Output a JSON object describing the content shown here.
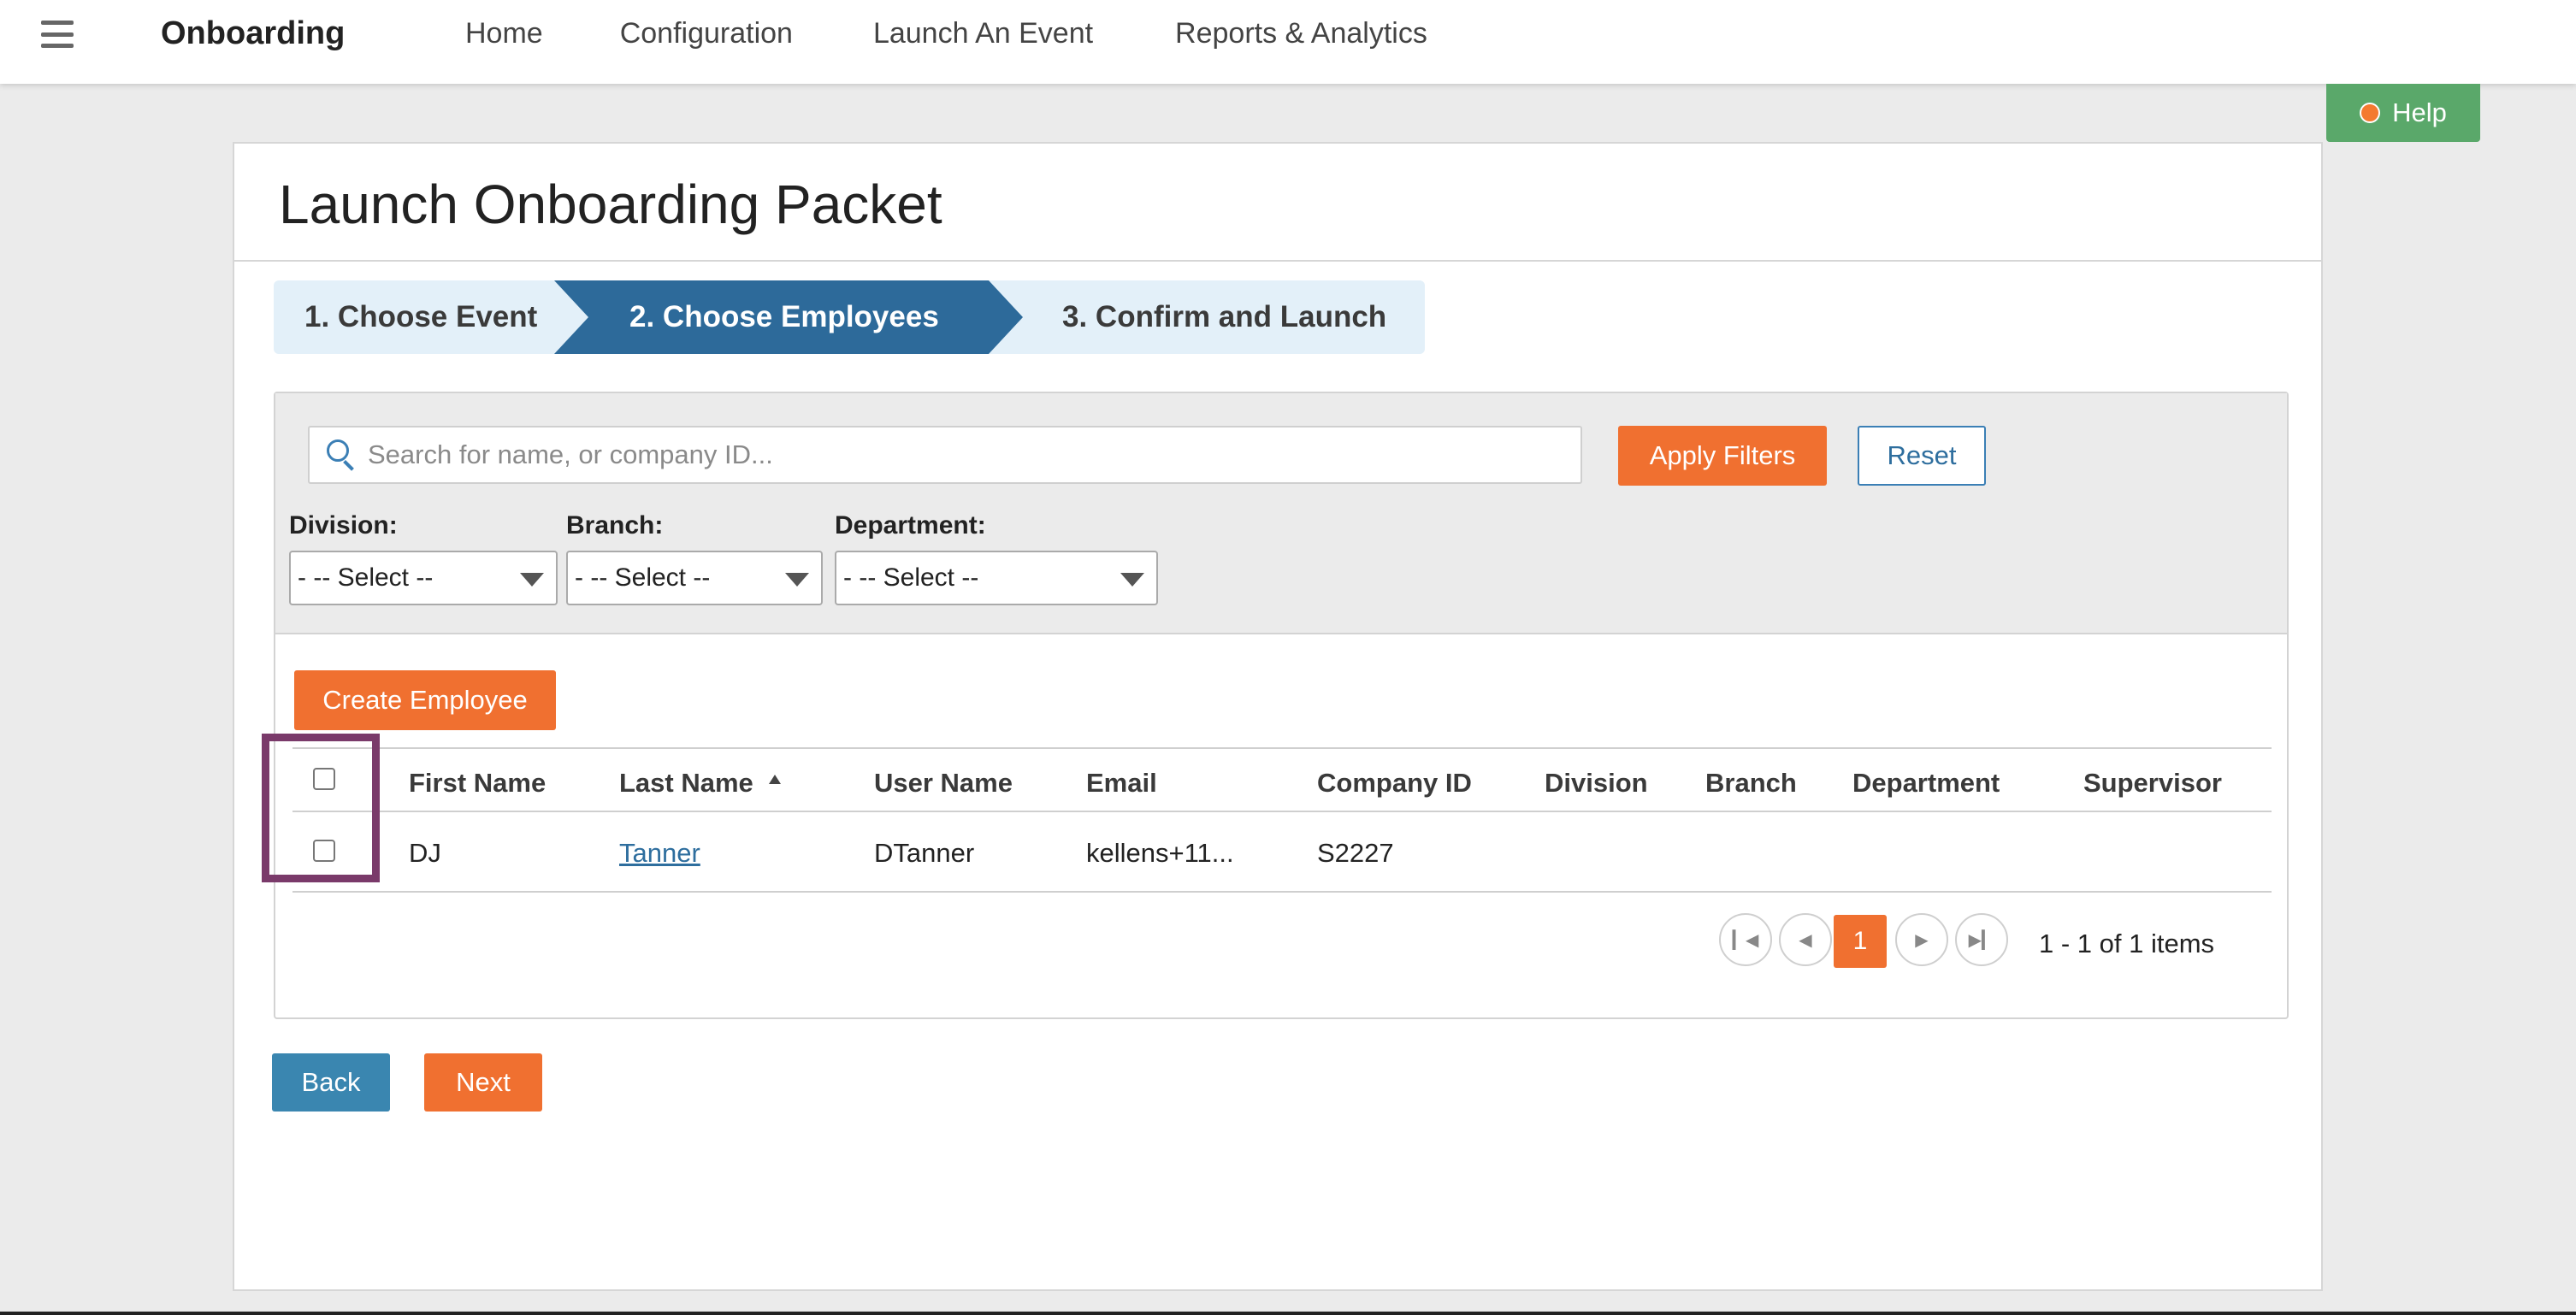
{
  "nav": {
    "brand": "Onboarding",
    "items": [
      "Home",
      "Configuration",
      "Launch An Event",
      "Reports & Analytics"
    ]
  },
  "help": {
    "label": "Help"
  },
  "page": {
    "title": "Launch Onboarding Packet"
  },
  "steps": [
    {
      "label": "1. Choose Event",
      "state": "done"
    },
    {
      "label": "2. Choose Employees",
      "state": "active"
    },
    {
      "label": "3. Confirm and Launch",
      "state": "pending"
    }
  ],
  "filters": {
    "search_placeholder": "Search for name, or company ID...",
    "apply_label": "Apply Filters",
    "reset_label": "Reset",
    "division": {
      "label": "Division:",
      "value": "- -- Select --"
    },
    "branch": {
      "label": "Branch:",
      "value": "- -- Select --"
    },
    "department": {
      "label": "Department:",
      "value": "- -- Select --"
    }
  },
  "actions": {
    "create_employee": "Create Employee",
    "back": "Back",
    "next": "Next"
  },
  "table": {
    "columns": [
      "First Name",
      "Last Name",
      "User Name",
      "Email",
      "Company ID",
      "Division",
      "Branch",
      "Department",
      "Supervisor"
    ],
    "sorted_column": "Last Name",
    "rows": [
      {
        "first_name": "DJ",
        "last_name": "Tanner",
        "user_name": "DTanner",
        "email": "kellens+11...",
        "company_id": "S2227",
        "division": "",
        "branch": "",
        "department": "",
        "supervisor": ""
      }
    ]
  },
  "pagination": {
    "current_page": "1",
    "summary": "1 - 1 of 1 items"
  },
  "colors": {
    "accent_orange": "#f07030",
    "step_active": "#2d6a9a",
    "step_bg": "#e3f0f9",
    "help_green": "#5aa86a",
    "highlight": "#7a3a6a"
  }
}
